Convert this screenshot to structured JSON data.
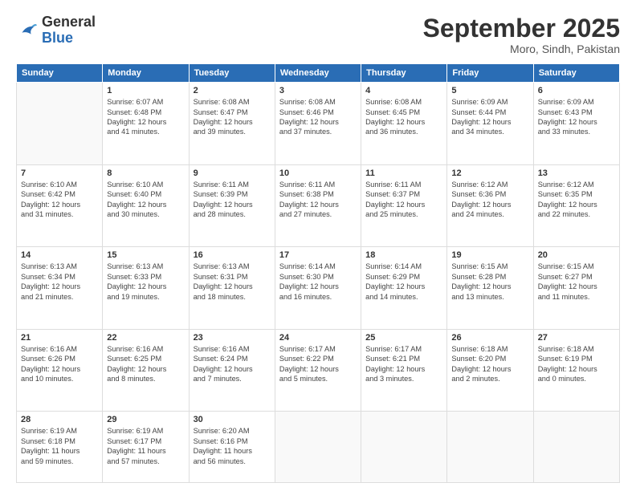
{
  "logo": {
    "general": "General",
    "blue": "Blue"
  },
  "header": {
    "month": "September 2025",
    "location": "Moro, Sindh, Pakistan"
  },
  "days": [
    "Sunday",
    "Monday",
    "Tuesday",
    "Wednesday",
    "Thursday",
    "Friday",
    "Saturday"
  ],
  "weeks": [
    [
      {
        "day": "",
        "info": ""
      },
      {
        "day": "1",
        "info": "Sunrise: 6:07 AM\nSunset: 6:48 PM\nDaylight: 12 hours\nand 41 minutes."
      },
      {
        "day": "2",
        "info": "Sunrise: 6:08 AM\nSunset: 6:47 PM\nDaylight: 12 hours\nand 39 minutes."
      },
      {
        "day": "3",
        "info": "Sunrise: 6:08 AM\nSunset: 6:46 PM\nDaylight: 12 hours\nand 37 minutes."
      },
      {
        "day": "4",
        "info": "Sunrise: 6:08 AM\nSunset: 6:45 PM\nDaylight: 12 hours\nand 36 minutes."
      },
      {
        "day": "5",
        "info": "Sunrise: 6:09 AM\nSunset: 6:44 PM\nDaylight: 12 hours\nand 34 minutes."
      },
      {
        "day": "6",
        "info": "Sunrise: 6:09 AM\nSunset: 6:43 PM\nDaylight: 12 hours\nand 33 minutes."
      }
    ],
    [
      {
        "day": "7",
        "info": "Sunrise: 6:10 AM\nSunset: 6:42 PM\nDaylight: 12 hours\nand 31 minutes."
      },
      {
        "day": "8",
        "info": "Sunrise: 6:10 AM\nSunset: 6:40 PM\nDaylight: 12 hours\nand 30 minutes."
      },
      {
        "day": "9",
        "info": "Sunrise: 6:11 AM\nSunset: 6:39 PM\nDaylight: 12 hours\nand 28 minutes."
      },
      {
        "day": "10",
        "info": "Sunrise: 6:11 AM\nSunset: 6:38 PM\nDaylight: 12 hours\nand 27 minutes."
      },
      {
        "day": "11",
        "info": "Sunrise: 6:11 AM\nSunset: 6:37 PM\nDaylight: 12 hours\nand 25 minutes."
      },
      {
        "day": "12",
        "info": "Sunrise: 6:12 AM\nSunset: 6:36 PM\nDaylight: 12 hours\nand 24 minutes."
      },
      {
        "day": "13",
        "info": "Sunrise: 6:12 AM\nSunset: 6:35 PM\nDaylight: 12 hours\nand 22 minutes."
      }
    ],
    [
      {
        "day": "14",
        "info": "Sunrise: 6:13 AM\nSunset: 6:34 PM\nDaylight: 12 hours\nand 21 minutes."
      },
      {
        "day": "15",
        "info": "Sunrise: 6:13 AM\nSunset: 6:33 PM\nDaylight: 12 hours\nand 19 minutes."
      },
      {
        "day": "16",
        "info": "Sunrise: 6:13 AM\nSunset: 6:31 PM\nDaylight: 12 hours\nand 18 minutes."
      },
      {
        "day": "17",
        "info": "Sunrise: 6:14 AM\nSunset: 6:30 PM\nDaylight: 12 hours\nand 16 minutes."
      },
      {
        "day": "18",
        "info": "Sunrise: 6:14 AM\nSunset: 6:29 PM\nDaylight: 12 hours\nand 14 minutes."
      },
      {
        "day": "19",
        "info": "Sunrise: 6:15 AM\nSunset: 6:28 PM\nDaylight: 12 hours\nand 13 minutes."
      },
      {
        "day": "20",
        "info": "Sunrise: 6:15 AM\nSunset: 6:27 PM\nDaylight: 12 hours\nand 11 minutes."
      }
    ],
    [
      {
        "day": "21",
        "info": "Sunrise: 6:16 AM\nSunset: 6:26 PM\nDaylight: 12 hours\nand 10 minutes."
      },
      {
        "day": "22",
        "info": "Sunrise: 6:16 AM\nSunset: 6:25 PM\nDaylight: 12 hours\nand 8 minutes."
      },
      {
        "day": "23",
        "info": "Sunrise: 6:16 AM\nSunset: 6:24 PM\nDaylight: 12 hours\nand 7 minutes."
      },
      {
        "day": "24",
        "info": "Sunrise: 6:17 AM\nSunset: 6:22 PM\nDaylight: 12 hours\nand 5 minutes."
      },
      {
        "day": "25",
        "info": "Sunrise: 6:17 AM\nSunset: 6:21 PM\nDaylight: 12 hours\nand 3 minutes."
      },
      {
        "day": "26",
        "info": "Sunrise: 6:18 AM\nSunset: 6:20 PM\nDaylight: 12 hours\nand 2 minutes."
      },
      {
        "day": "27",
        "info": "Sunrise: 6:18 AM\nSunset: 6:19 PM\nDaylight: 12 hours\nand 0 minutes."
      }
    ],
    [
      {
        "day": "28",
        "info": "Sunrise: 6:19 AM\nSunset: 6:18 PM\nDaylight: 11 hours\nand 59 minutes."
      },
      {
        "day": "29",
        "info": "Sunrise: 6:19 AM\nSunset: 6:17 PM\nDaylight: 11 hours\nand 57 minutes."
      },
      {
        "day": "30",
        "info": "Sunrise: 6:20 AM\nSunset: 6:16 PM\nDaylight: 11 hours\nand 56 minutes."
      },
      {
        "day": "",
        "info": ""
      },
      {
        "day": "",
        "info": ""
      },
      {
        "day": "",
        "info": ""
      },
      {
        "day": "",
        "info": ""
      }
    ]
  ]
}
